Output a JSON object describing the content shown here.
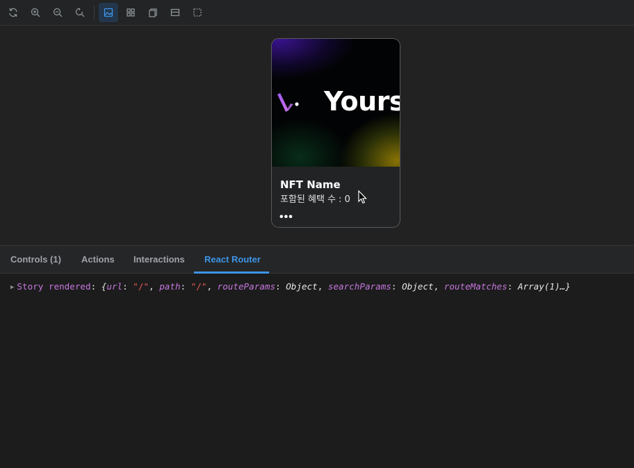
{
  "toolbar": {
    "buttons": [
      {
        "icon": "refresh-icon"
      },
      {
        "icon": "zoom-in-icon"
      },
      {
        "icon": "zoom-out-icon"
      },
      {
        "icon": "zoom-reset-icon"
      },
      {
        "icon": "background-image-icon",
        "active": true
      },
      {
        "icon": "grid-icon"
      },
      {
        "icon": "viewport-icon"
      },
      {
        "icon": "measure-icon"
      },
      {
        "icon": "outline-icon"
      }
    ]
  },
  "card": {
    "brand_word": "Yours",
    "name": "NFT Name",
    "benefit_text": "포함된 혜택 수 : 0",
    "more": "•••"
  },
  "addons": {
    "tabs": [
      "Controls (1)",
      "Actions",
      "Interactions",
      "React Router"
    ],
    "active_tab": "React Router"
  },
  "log": {
    "label": "Story rendered",
    "colon": ":",
    "open": "{",
    "url_key": "url",
    "url_val": "\"/\"",
    "path_key": "path",
    "path_val": "\"/\"",
    "route_params_key": "routeParams",
    "route_params_val": "Object",
    "search_params_key": "searchParams",
    "search_params_val": "Object",
    "route_matches_key": "routeMatches",
    "route_matches_val": "Array(1)",
    "ellipsis": "…}"
  },
  "colors": {
    "accent": "#3d95e8",
    "key": "#c678dd",
    "string": "#e55a4f"
  }
}
